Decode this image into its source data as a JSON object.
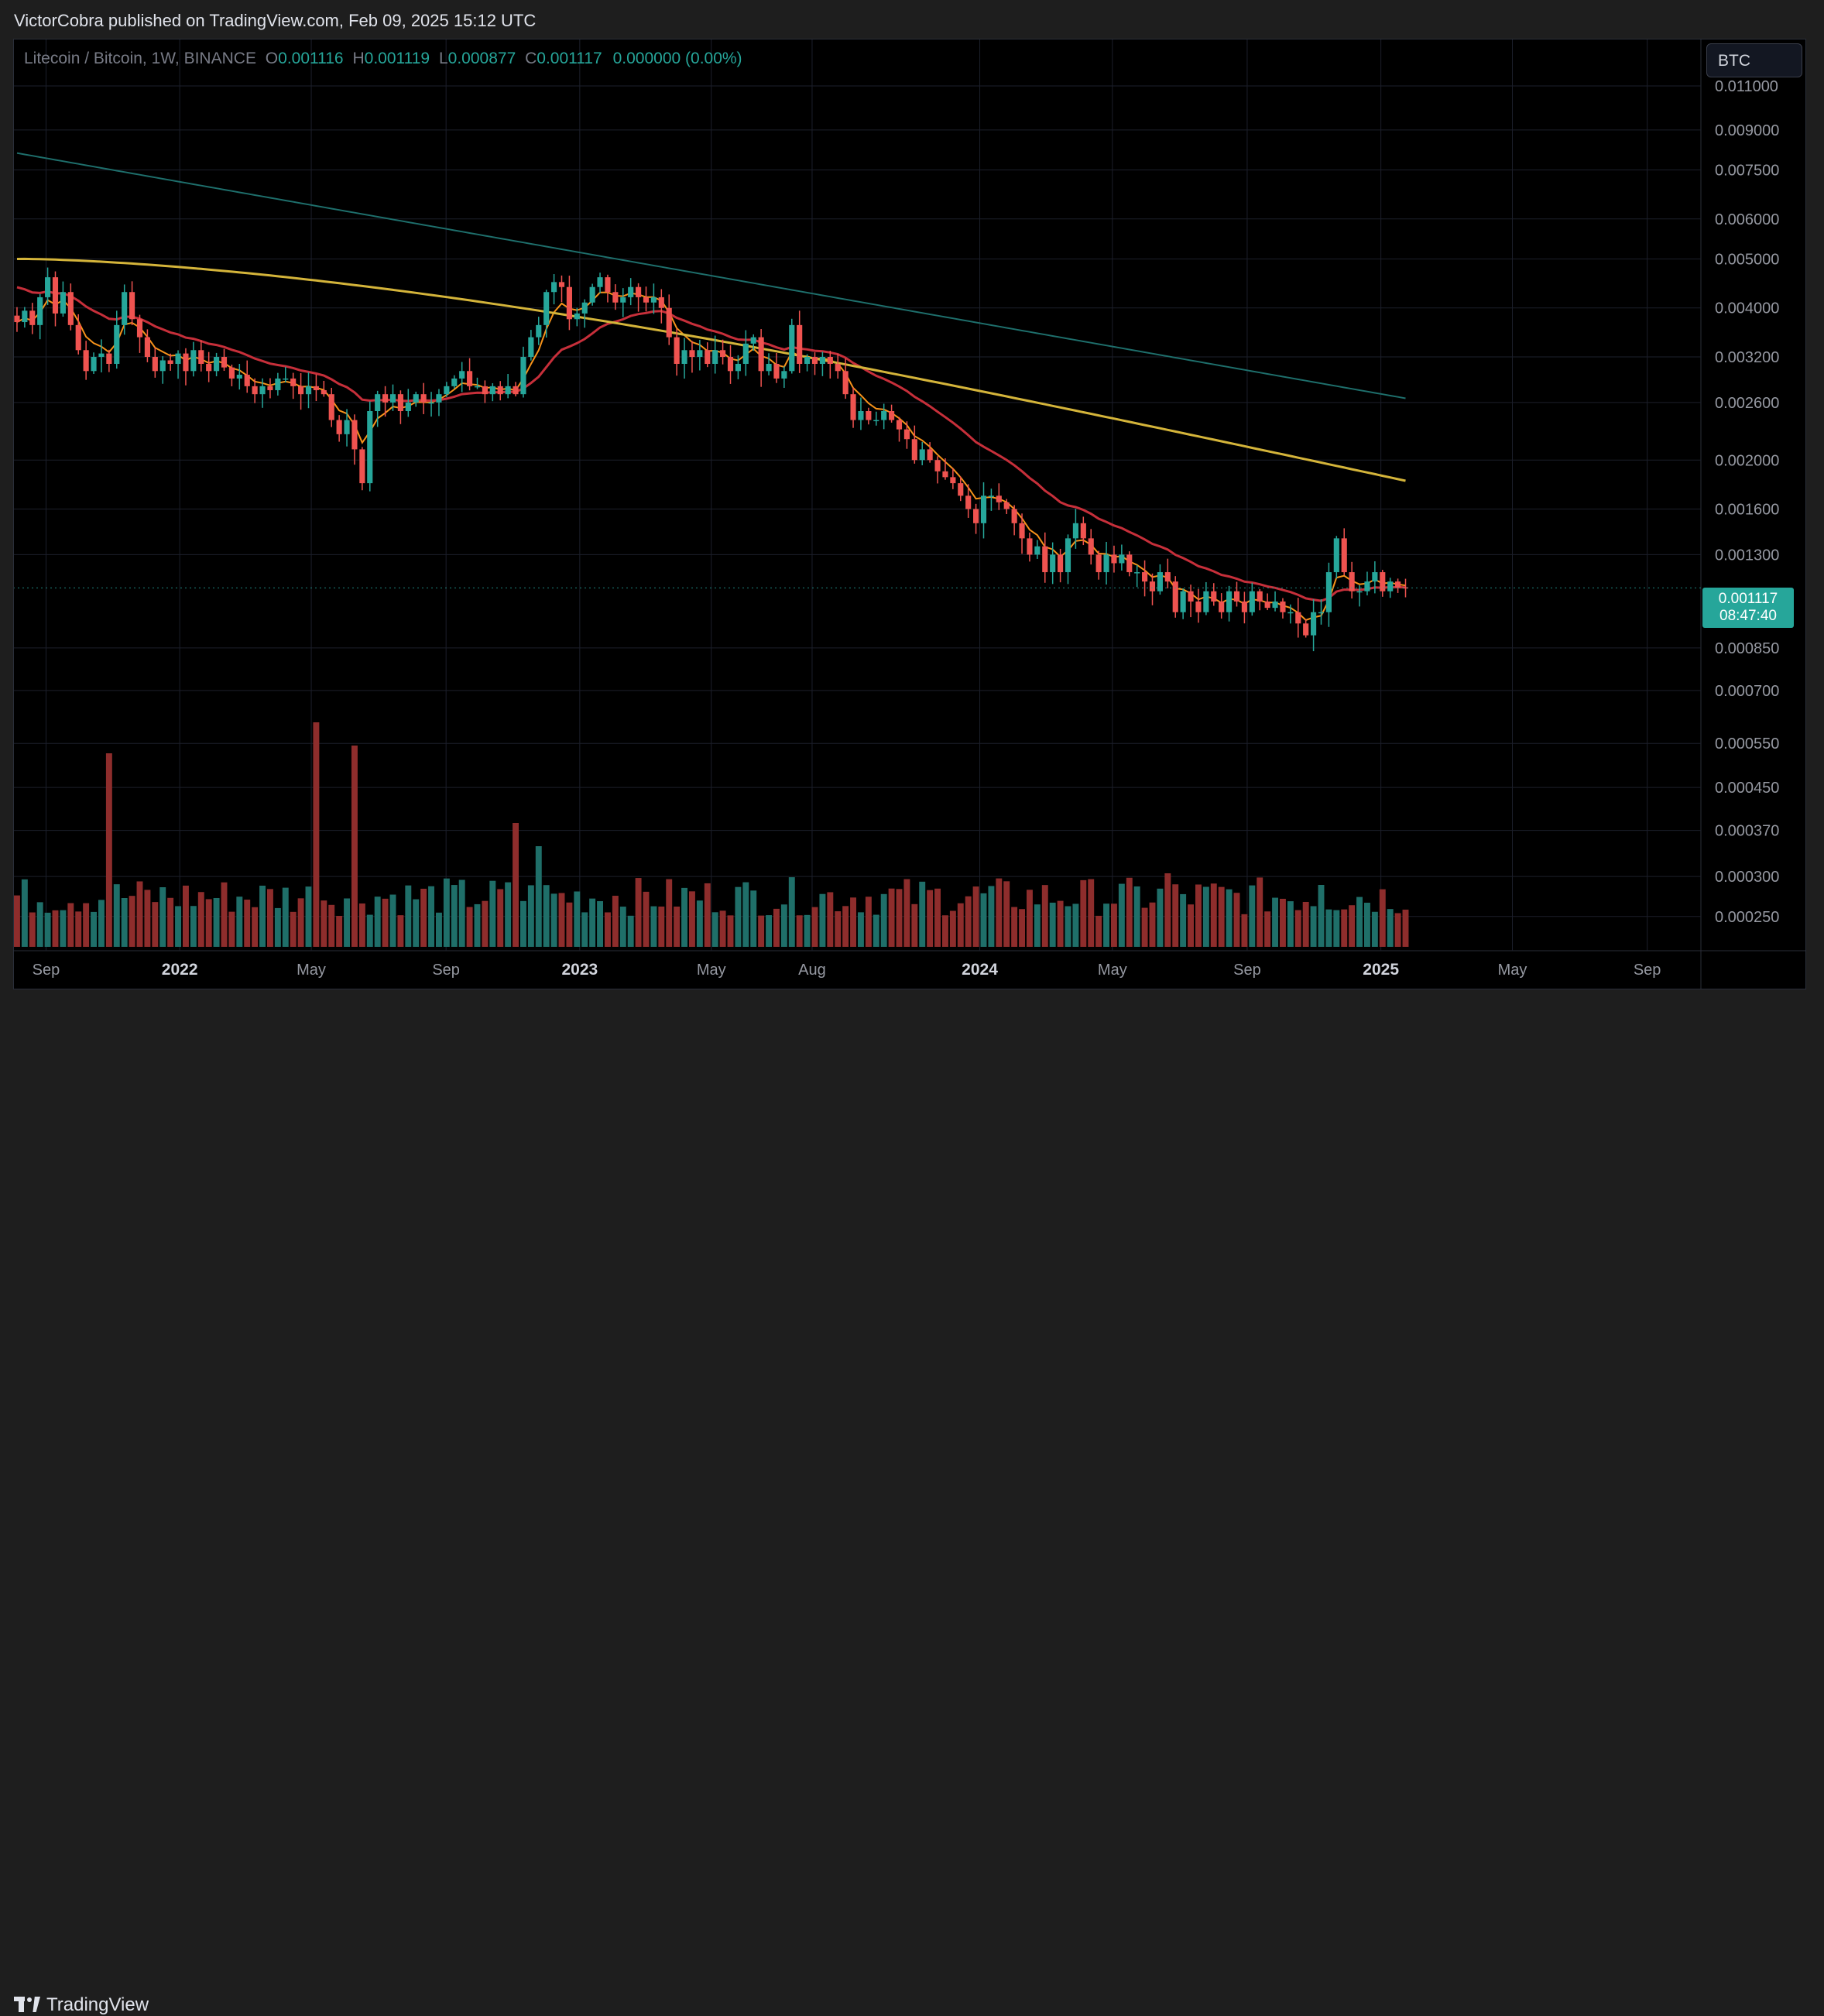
{
  "header": {
    "published_text": "VictorCobra published on TradingView.com, Feb 09, 2025 15:12 UTC"
  },
  "legend": {
    "symbol": "Litecoin / Bitcoin, 1W, BINANCE",
    "o_label": "O",
    "o_value": "0.001116",
    "h_label": "H",
    "h_value": "0.001119",
    "l_label": "L",
    "l_value": "0.000877",
    "c_label": "C",
    "c_value": "0.001117",
    "change": "0.000000 (0.00%)"
  },
  "currency_button": "BTC",
  "price_tag": {
    "price": "0.001117",
    "countdown": "08:47:40"
  },
  "footer": {
    "brand": "TradingView"
  },
  "colors": {
    "up": "#26a69a",
    "down": "#ef5350",
    "ma_fast": "#f7931a",
    "ma_mid": "#c62f3a",
    "ma_slow": "#d4b43a",
    "ma_long": "#1e6f6c",
    "tag": "#26a69a"
  },
  "chart_data": {
    "type": "candlestick",
    "scale": "log",
    "ylim": [
      0.00022,
      0.0128
    ],
    "y_ticks": [
      "0.011000",
      "0.009000",
      "0.007500",
      "0.006000",
      "0.005000",
      "0.004000",
      "0.003200",
      "0.002600",
      "0.002000",
      "0.001600",
      "0.001300",
      "0.000850",
      "0.000700",
      "0.000550",
      "0.000450",
      "0.000370",
      "0.000300",
      "0.000250"
    ],
    "x_ticks": [
      {
        "label": "Sep",
        "date": "2021-09-01"
      },
      {
        "label": "2022",
        "date": "2022-01-01"
      },
      {
        "label": "May",
        "date": "2022-05-01"
      },
      {
        "label": "Sep",
        "date": "2022-09-01"
      },
      {
        "label": "2023",
        "date": "2023-01-01"
      },
      {
        "label": "May",
        "date": "2023-05-01"
      },
      {
        "label": "Aug",
        "date": "2023-08-01"
      },
      {
        "label": "2024",
        "date": "2024-01-01"
      },
      {
        "label": "May",
        "date": "2024-05-01"
      },
      {
        "label": "Sep",
        "date": "2024-09-01"
      },
      {
        "label": "2025",
        "date": "2025-01-01"
      },
      {
        "label": "May",
        "date": "2025-05-01"
      },
      {
        "label": "Sep",
        "date": "2025-09-01"
      }
    ],
    "x_start": "2021-08-02",
    "interval_days": 7,
    "closes": [
      0.00375,
      0.00395,
      0.0037,
      0.0042,
      0.0046,
      0.0039,
      0.0043,
      0.0037,
      0.0033,
      0.003,
      0.0032,
      0.00325,
      0.0031,
      0.0037,
      0.0043,
      0.0038,
      0.0035,
      0.0032,
      0.003,
      0.00315,
      0.0031,
      0.00325,
      0.003,
      0.0033,
      0.0031,
      0.003,
      0.0032,
      0.00305,
      0.0029,
      0.00295,
      0.0028,
      0.0027,
      0.0028,
      0.00275,
      0.0029,
      0.0029,
      0.0028,
      0.0027,
      0.0028,
      0.00275,
      0.0027,
      0.0024,
      0.00225,
      0.0024,
      0.0021,
      0.0018,
      0.0025,
      0.0027,
      0.0026,
      0.0027,
      0.0025,
      0.0026,
      0.0027,
      0.0026,
      0.0026,
      0.0027,
      0.0028,
      0.0029,
      0.003,
      0.0028,
      0.0028,
      0.0027,
      0.0028,
      0.0027,
      0.0028,
      0.0027,
      0.0032,
      0.0035,
      0.0037,
      0.0043,
      0.0045,
      0.0044,
      0.0038,
      0.0039,
      0.0041,
      0.0044,
      0.0046,
      0.0043,
      0.0041,
      0.0042,
      0.0044,
      0.0042,
      0.0041,
      0.0042,
      0.004,
      0.0035,
      0.0031,
      0.0033,
      0.0032,
      0.0033,
      0.0031,
      0.0033,
      0.0032,
      0.003,
      0.0031,
      0.0034,
      0.0035,
      0.003,
      0.0031,
      0.0029,
      0.003,
      0.0037,
      0.0031,
      0.0032,
      0.0031,
      0.0032,
      0.0031,
      0.003,
      0.0027,
      0.0024,
      0.0025,
      0.0024,
      0.0024,
      0.0025,
      0.0024,
      0.0023,
      0.0022,
      0.002,
      0.0021,
      0.002,
      0.0019,
      0.00185,
      0.0018,
      0.0017,
      0.0016,
      0.0015,
      0.0017,
      0.0017,
      0.00165,
      0.0016,
      0.0015,
      0.0014,
      0.0013,
      0.00135,
      0.0012,
      0.0013,
      0.0012,
      0.0014,
      0.0015,
      0.0014,
      0.0013,
      0.0012,
      0.0013,
      0.00125,
      0.0013,
      0.0012,
      0.0012,
      0.00115,
      0.0011,
      0.0012,
      0.00115,
      0.001,
      0.0011,
      0.00105,
      0.001,
      0.0011,
      0.00105,
      0.001,
      0.0011,
      0.00105,
      0.001,
      0.0011,
      0.00105,
      0.00102,
      0.00105,
      0.001,
      0.001,
      0.00095,
      0.0009,
      0.001,
      0.001,
      0.0012,
      0.0014,
      0.0012,
      0.0011,
      0.0011,
      0.00115,
      0.0012,
      0.0011,
      0.00115,
      0.00112,
      0.001117
    ],
    "volume_bar_count": 186
  }
}
